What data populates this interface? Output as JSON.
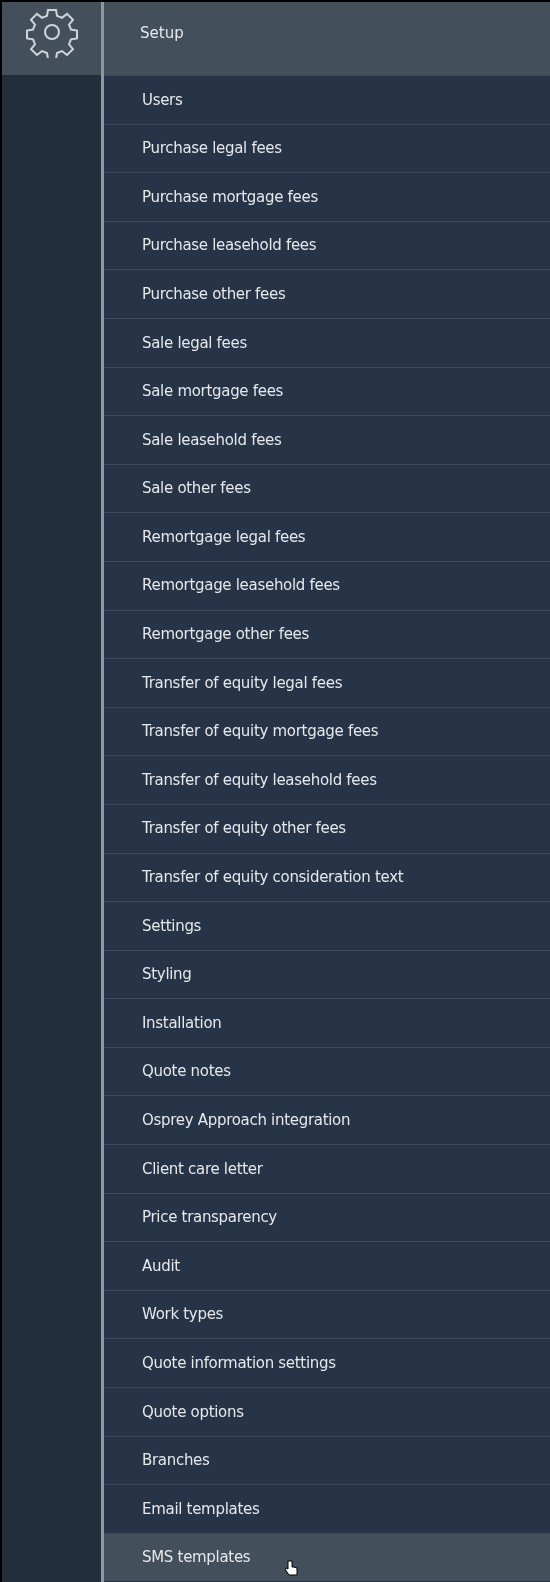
{
  "menu": {
    "title": "Setup",
    "items": [
      {
        "label": "Users",
        "selected": false
      },
      {
        "label": "Purchase legal fees",
        "selected": false
      },
      {
        "label": "Purchase mortgage fees",
        "selected": false
      },
      {
        "label": "Purchase leasehold fees",
        "selected": false
      },
      {
        "label": "Purchase other fees",
        "selected": false
      },
      {
        "label": "Sale legal fees",
        "selected": false
      },
      {
        "label": "Sale mortgage fees",
        "selected": false
      },
      {
        "label": "Sale leasehold fees",
        "selected": false
      },
      {
        "label": "Sale other fees",
        "selected": false
      },
      {
        "label": "Remortgage legal fees",
        "selected": false
      },
      {
        "label": "Remortgage leasehold fees",
        "selected": false
      },
      {
        "label": "Remortgage other fees",
        "selected": false
      },
      {
        "label": "Transfer of equity legal fees",
        "selected": false
      },
      {
        "label": "Transfer of equity mortgage fees",
        "selected": false
      },
      {
        "label": "Transfer of equity leasehold fees",
        "selected": false
      },
      {
        "label": "Transfer of equity other fees",
        "selected": false
      },
      {
        "label": "Transfer of equity consideration text",
        "selected": false
      },
      {
        "label": "Settings",
        "selected": false
      },
      {
        "label": "Styling",
        "selected": false
      },
      {
        "label": "Installation",
        "selected": false
      },
      {
        "label": "Quote notes",
        "selected": false
      },
      {
        "label": "Osprey Approach integration",
        "selected": false
      },
      {
        "label": "Client care letter",
        "selected": false
      },
      {
        "label": "Price transparency",
        "selected": false
      },
      {
        "label": "Audit",
        "selected": false
      },
      {
        "label": "Work types",
        "selected": false
      },
      {
        "label": "Quote information settings",
        "selected": false
      },
      {
        "label": "Quote options",
        "selected": false
      },
      {
        "label": "Branches",
        "selected": false
      },
      {
        "label": "Email templates",
        "selected": false
      },
      {
        "label": "SMS templates",
        "selected": true
      }
    ]
  }
}
